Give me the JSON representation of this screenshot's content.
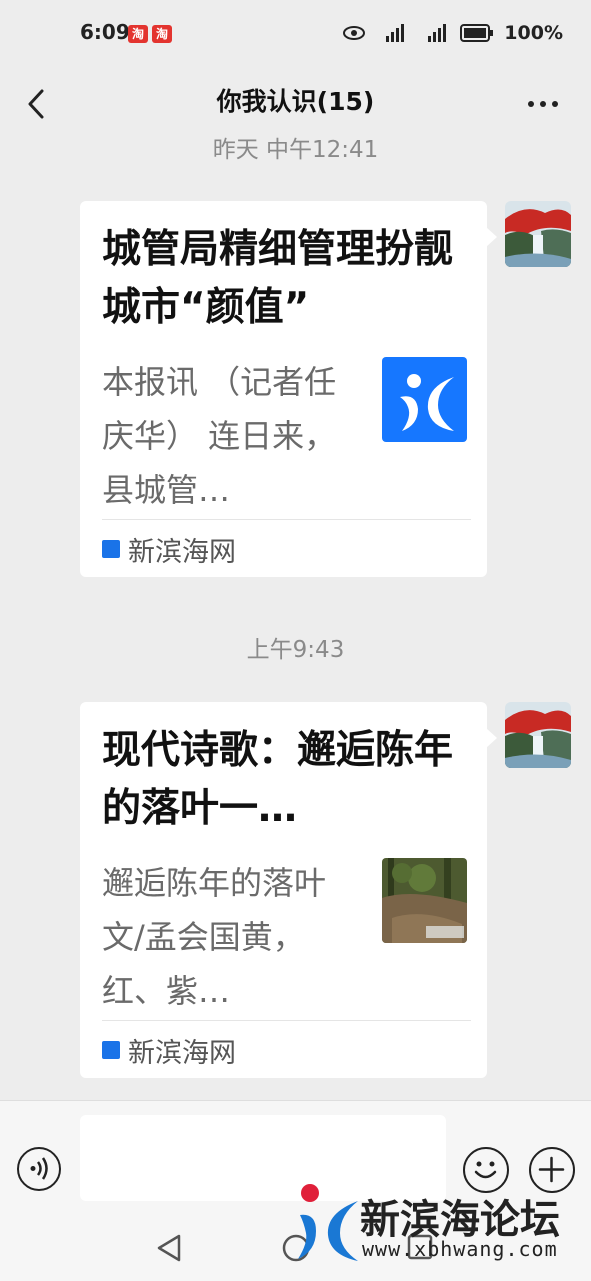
{
  "status_bar": {
    "time": "6:09",
    "badges": [
      "淘",
      "淘"
    ],
    "battery": "100%"
  },
  "header": {
    "title": "你我认识(15)"
  },
  "messages": [
    {
      "timestamp": "昨天 中午12:41",
      "title": "城管局精细管理扮靓城市“颜值”",
      "description": "本报讯 （记者任庆华） 连日来，县城管…",
      "source": "新滨海网",
      "thumbnail": "xbh-logo"
    },
    {
      "timestamp": "上午9:43",
      "title": "现代诗歌：邂逅陈年的落叶一…",
      "description": "邂逅陈年的落叶文/孟会国黄，红、紫…",
      "source": "新滨海网",
      "thumbnail": "forest-photo"
    }
  ],
  "watermark": {
    "brand": "新滨海论坛",
    "url": "www.xbhwang.com"
  },
  "icons": {
    "back": "chevron-left-icon",
    "more": "more-icon",
    "voice": "voice-icon",
    "emoji": "emoji-icon",
    "plus": "plus-icon"
  },
  "colors": {
    "background": "#ededed",
    "card": "#ffffff",
    "badge": "#e3342f",
    "source_icon": "#1a73e8"
  }
}
